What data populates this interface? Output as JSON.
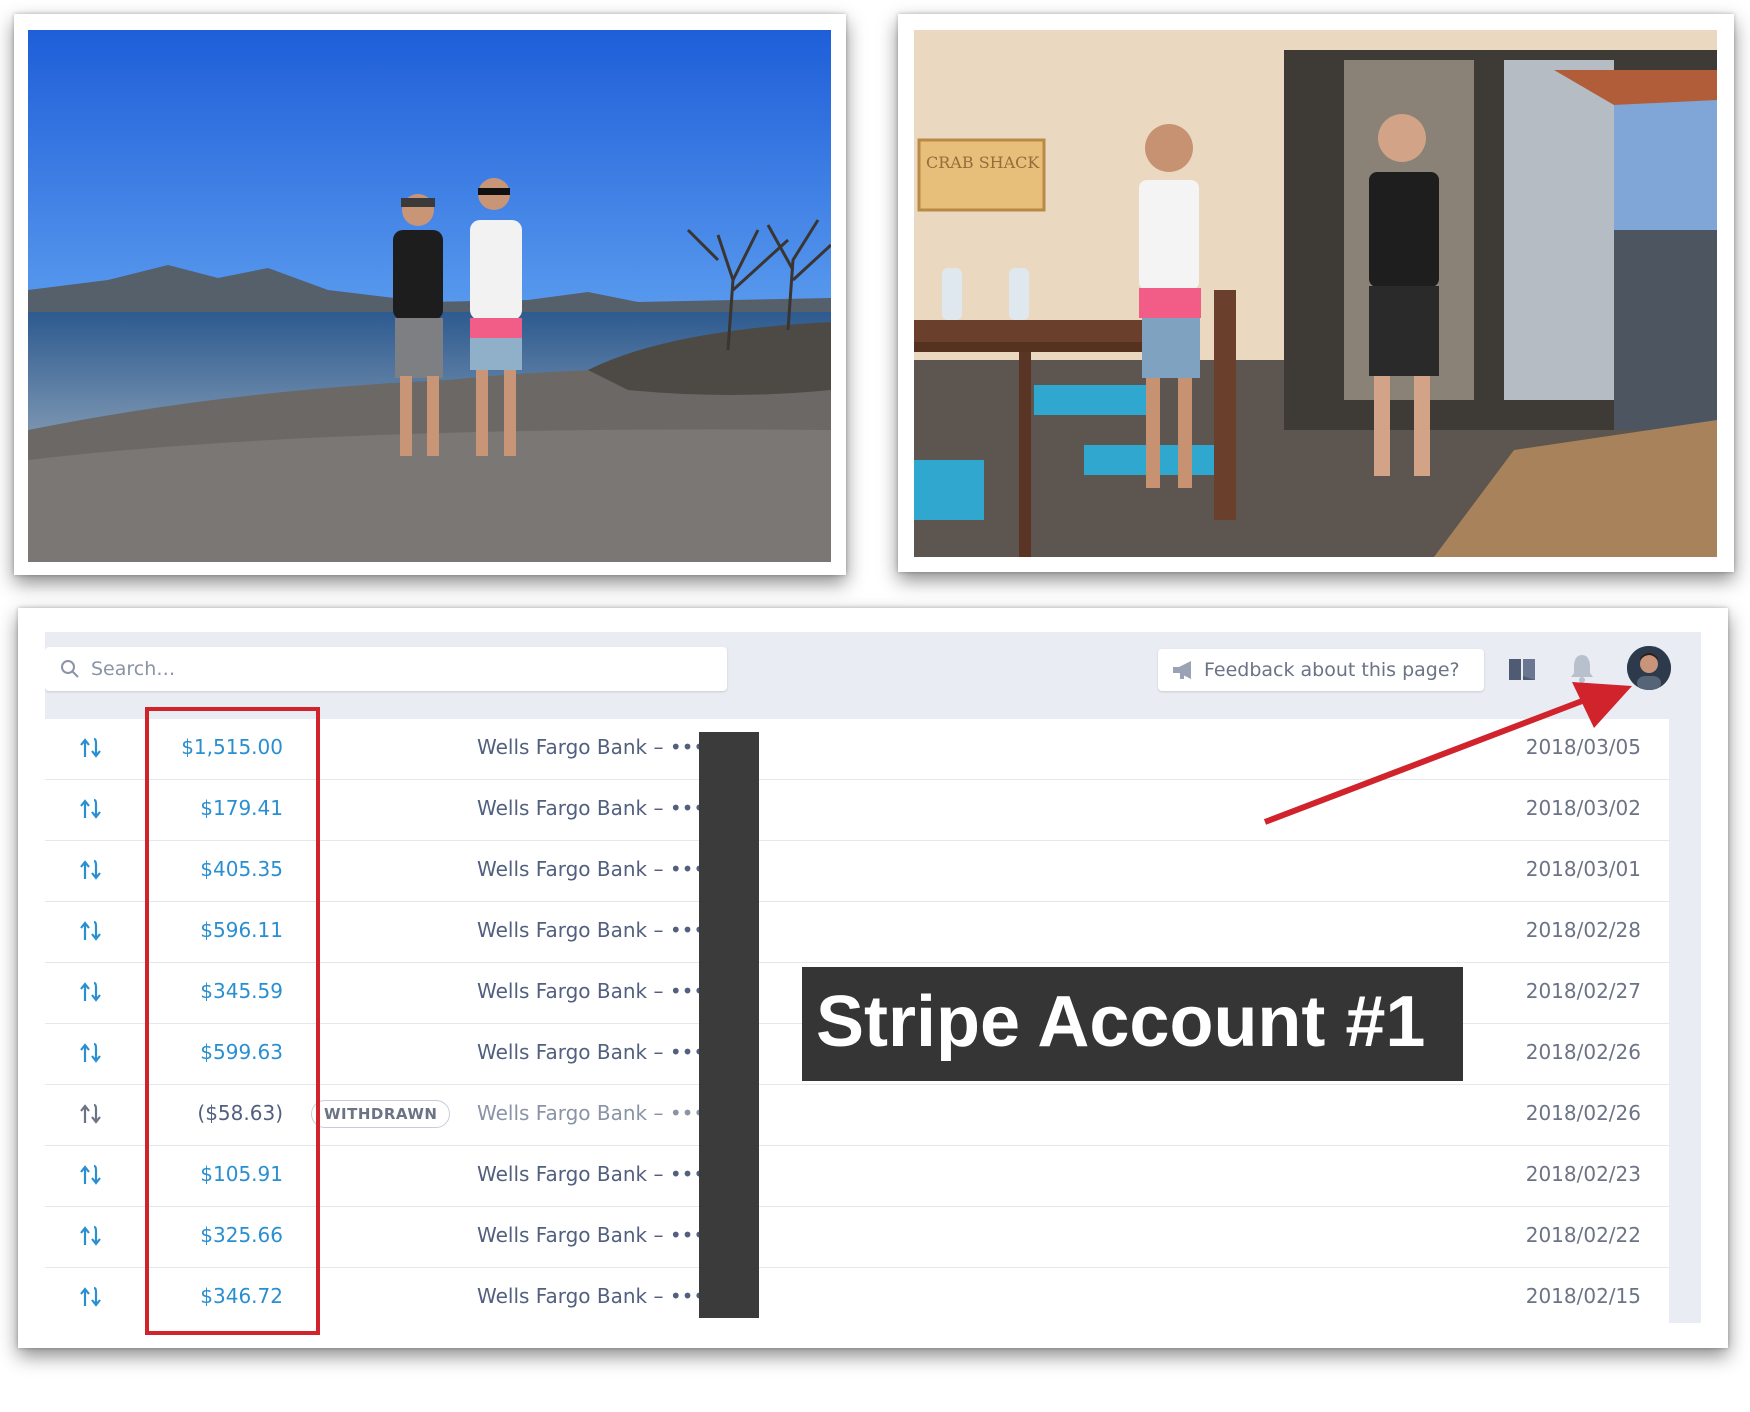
{
  "dashboard": {
    "search": {
      "placeholder": "Search…"
    },
    "feedback_label": "Feedback about this page?",
    "caption": "Stripe Account #1",
    "transfers": [
      {
        "amount": "$1,515.00",
        "bank": "Wells Fargo Bank – ••••",
        "date": "2018/03/05",
        "status": ""
      },
      {
        "amount": "$179.41",
        "bank": "Wells Fargo Bank – ••••",
        "date": "2018/03/02",
        "status": ""
      },
      {
        "amount": "$405.35",
        "bank": "Wells Fargo Bank – ••••",
        "date": "2018/03/01",
        "status": ""
      },
      {
        "amount": "$596.11",
        "bank": "Wells Fargo Bank – ••••",
        "date": "2018/02/28",
        "status": ""
      },
      {
        "amount": "$345.59",
        "bank": "Wells Fargo Bank – ••••",
        "date": "2018/02/27",
        "status": ""
      },
      {
        "amount": "$599.63",
        "bank": "Wells Fargo Bank – ••••",
        "date": "2018/02/26",
        "status": ""
      },
      {
        "amount": "($58.63)",
        "bank": "Wells Fargo Bank – ••••",
        "date": "2018/02/26",
        "status": "WITHDRAWN"
      },
      {
        "amount": "$105.91",
        "bank": "Wells Fargo Bank – ••••",
        "date": "2018/02/23",
        "status": ""
      },
      {
        "amount": "$325.66",
        "bank": "Wells Fargo Bank – ••••",
        "date": "2018/02/22",
        "status": ""
      },
      {
        "amount": "$346.72",
        "bank": "Wells Fargo Bank – ••••",
        "date": "2018/02/15",
        "status": ""
      }
    ]
  },
  "photos": {
    "beach": {
      "signboard": ""
    },
    "room": {
      "sign_text": "CRAB SHACK"
    }
  },
  "icons": {
    "search": "search-icon",
    "feedback": "megaphone-icon",
    "docs": "book-icon",
    "notifications": "bell-icon",
    "transfer": "transfer-arrows-icon"
  },
  "colors": {
    "link_blue": "#2a8fd0",
    "annotation_red": "#d0232c",
    "caption_bg": "#353535",
    "header_bg": "#e9edf3"
  }
}
